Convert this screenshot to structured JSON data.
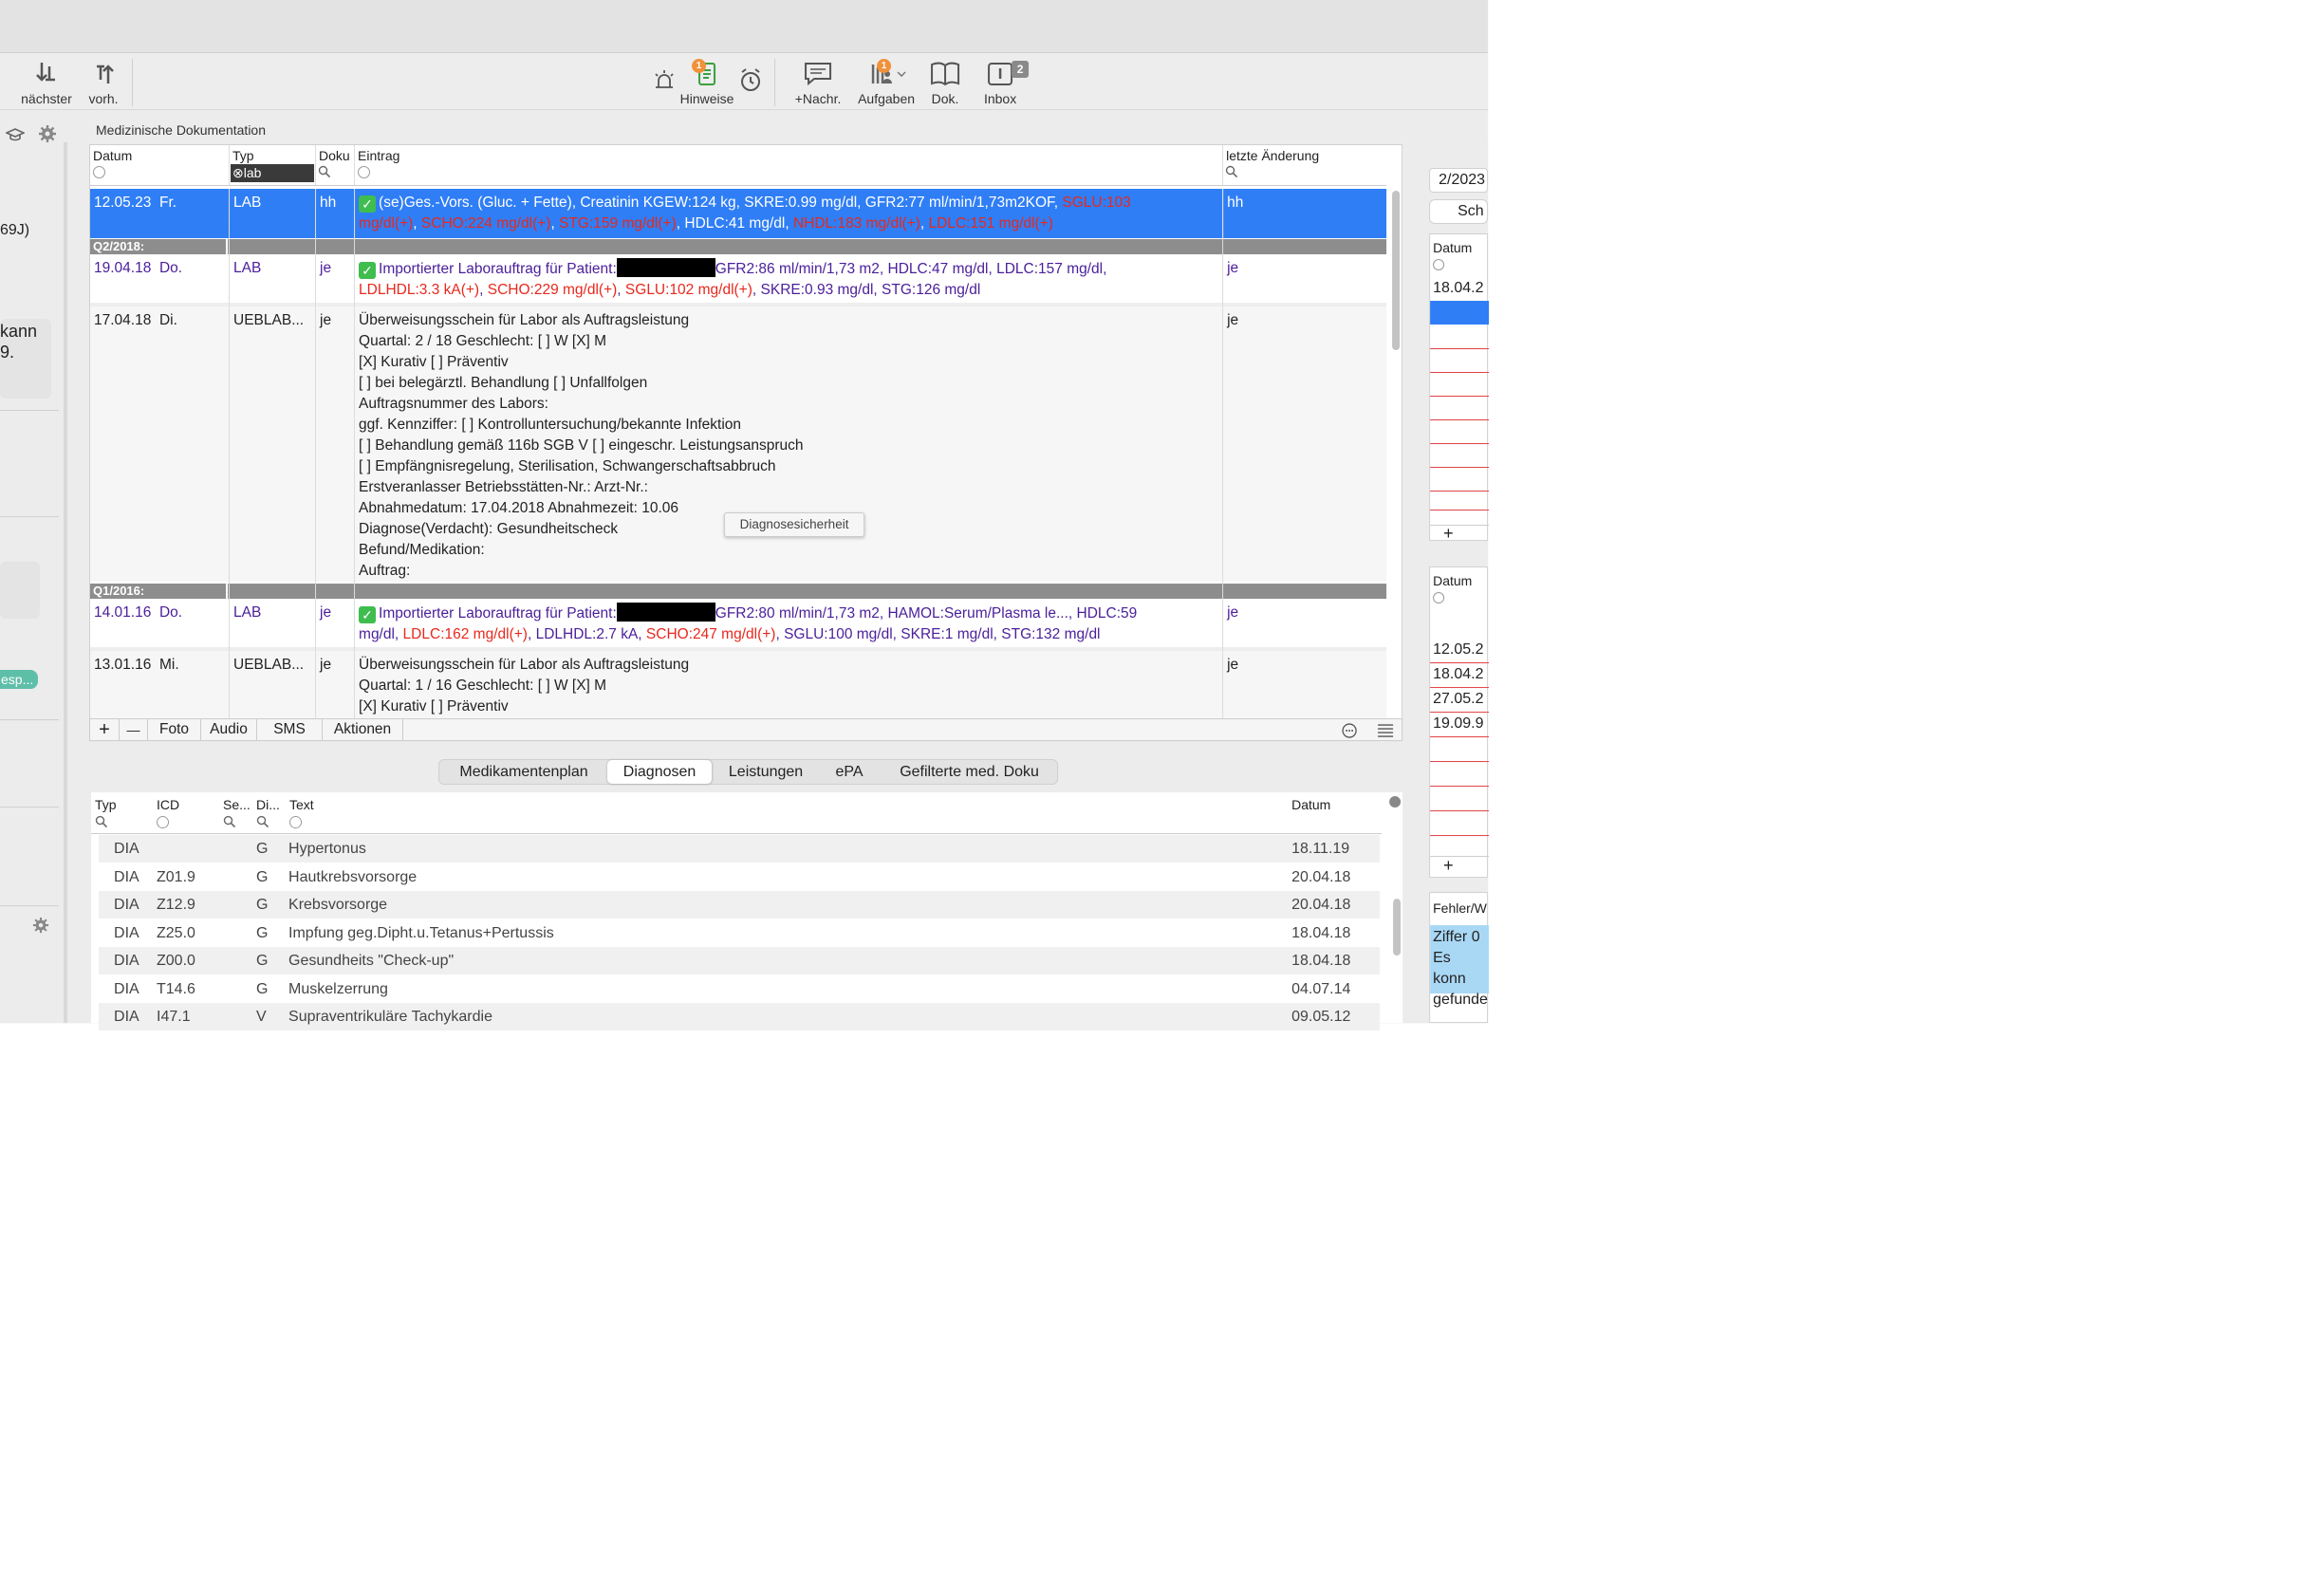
{
  "toolbar": {
    "next": "nächster",
    "prev": "vorh.",
    "hints": "Hinweise",
    "new_msg": "+Nachr.",
    "tasks": "Aufgaben",
    "doc": "Dok.",
    "inbox": "Inbox",
    "hints_badge": "1",
    "tasks_badge": "1",
    "inbox_badge": "2"
  },
  "section_title": "Medizinische Dokumentation",
  "left": {
    "frag1": "69J)",
    "frag2": "kann",
    "frag3": "9.",
    "chip": "esp..."
  },
  "columns": {
    "date": "Datum",
    "type": "Typ",
    "type_filter": "lab",
    "doku": "Doku",
    "entry": "Eintrag",
    "last": "letzte Änderung"
  },
  "rows": {
    "r1": {
      "date": "12.05.23",
      "day": "Fr.",
      "type": "LAB",
      "doku": "hh",
      "last": "hh",
      "a": "(se)Ges.-Vors. (Gluc. + Fette), Creatinin KGEW:124 kg, SKRE:0.99 mg/dl, GFR2:77 ml/min/1,73m2KOF,",
      "b": "SGLU:103",
      "c": "mg/dl(+)",
      "d": "SCHO:224 mg/dl(+)",
      "e": "STG:159 mg/dl(+)",
      "f": "HDLC:41 mg/dl,",
      "g": "NHDL:183 mg/dl(+)",
      "h": "LDLC:151 mg/dl(+)"
    },
    "q1": "Q2/2018:",
    "r2": {
      "date": "19.04.18",
      "day": "Do.",
      "type": "LAB",
      "doku": "je",
      "last": "je",
      "a": "Importierter Laborauftrag für Patient:",
      "b": "GFR2:86 ml/min/1,73 m2, HDLC:47 mg/dl, LDLC:157 mg/dl,",
      "c": "LDLHDL:3.3 kA(+)",
      "d": "SCHO:229 mg/dl(+)",
      "e": "SGLU:102 mg/dl(+)",
      "f": "SKRE:0.93 mg/dl, STG:126 mg/dl"
    },
    "r3": {
      "date": "17.04.18",
      "day": "Di.",
      "type": "UEBLAB...",
      "doku": "je",
      "last": "je",
      "lines": [
        "Überweisungsschein für Labor als Auftragsleistung",
        "Quartal: 2 / 18   Geschlecht: [ ] W  [X] M",
        "[X] Kurativ   [ ] Präventiv",
        "[ ] bei belegärztl. Behandlung   [ ] Unfallfolgen",
        "Auftragsnummer des Labors:",
        "ggf. Kennziffer:    [ ] Kontrolluntersuchung/bekannte Infektion",
        "[ ] Behandlung gemäß  116b SGB V   [ ] eingeschr. Leistungsanspruch",
        "[ ] Empfängnisregelung, Sterilisation, Schwangerschaftsabbruch",
        "Erstveranlasser Betriebsstätten-Nr.:    Arzt-Nr.:",
        "Abnahmedatum: 17.04.2018   Abnahmezeit: 10.06",
        "Diagnose(Verdacht): Gesundheitscheck",
        "Befund/Medikation:",
        "Auftrag:"
      ]
    },
    "q2": "Q1/2016:",
    "r4": {
      "date": "14.01.16",
      "day": "Do.",
      "type": "LAB",
      "doku": "je",
      "last": "je",
      "a": "Importierter Laborauftrag für Patient:",
      "b": "GFR2:80 ml/min/1,73 m2, HAMOL:Serum/Plasma le..., HDLC:59",
      "c": "mg/dl,",
      "d": "LDLC:162 mg/dl(+)",
      "e": "LDLHDL:2.7 kA,",
      "f": "SCHO:247 mg/dl(+)",
      "g": "SGLU:100 mg/dl, SKRE:1 mg/dl, STG:132 mg/dl"
    },
    "r5": {
      "date": "13.01.16",
      "day": "Mi.",
      "type": "UEBLAB...",
      "doku": "je",
      "last": "je",
      "lines": [
        "Überweisungsschein für Labor als Auftragsleistung",
        "Quartal: 1 / 16   Geschlecht: [ ] W  [X] M",
        "[X] Kurativ   [ ] Präventiv"
      ]
    }
  },
  "tooltip": "Diagnosesicherheit",
  "footer": {
    "add": "+",
    "remove": "—",
    "foto": "Foto",
    "audio": "Audio",
    "sms": "SMS",
    "aktionen": "Aktionen"
  },
  "tabs": [
    "Medikamentenplan",
    "Diagnosen",
    "Leistungen",
    "ePA",
    "Gefilterte med. Doku"
  ],
  "diag_cols": {
    "typ": "Typ",
    "icd": "ICD",
    "se": "Se...",
    "di": "Di...",
    "text": "Text",
    "datum": "Datum"
  },
  "diagnoses": [
    {
      "typ": "DIA",
      "icd": "",
      "di": "G",
      "text": "Hypertonus",
      "date": "18.11.19"
    },
    {
      "typ": "DIA",
      "icd": "Z01.9",
      "di": "G",
      "text": "Hautkrebsvorsorge",
      "date": "20.04.18"
    },
    {
      "typ": "DIA",
      "icd": "Z12.9",
      "di": "G",
      "text": "Krebsvorsorge",
      "date": "20.04.18"
    },
    {
      "typ": "DIA",
      "icd": "Z25.0",
      "di": "G",
      "text": "Impfung geg.Dipht.u.Tetanus+Pertussis",
      "date": "18.04.18"
    },
    {
      "typ": "DIA",
      "icd": "Z00.0",
      "di": "G",
      "text": "Gesundheits \"Check-up\"",
      "date": "18.04.18"
    },
    {
      "typ": "DIA",
      "icd": "T14.6",
      "di": "G",
      "text": "Muskelzerrung",
      "date": "04.07.14"
    },
    {
      "typ": "DIA",
      "icd": "I47.1",
      "di": "V",
      "text": "Supraventrikuläre Tachykardie",
      "date": "09.05.12"
    }
  ],
  "right": {
    "top": "2/2023",
    "btn": "Sch",
    "datum1": "Datum",
    "d1": "18.04.2",
    "datum2": "Datum",
    "dates": [
      "12.05.2",
      "18.04.2",
      "27.05.2",
      "19.09.9"
    ],
    "fehler": "Fehler/W",
    "msg1": "Ziffer 0",
    "msg2": "Es konn",
    "msg3": "gefunde"
  }
}
